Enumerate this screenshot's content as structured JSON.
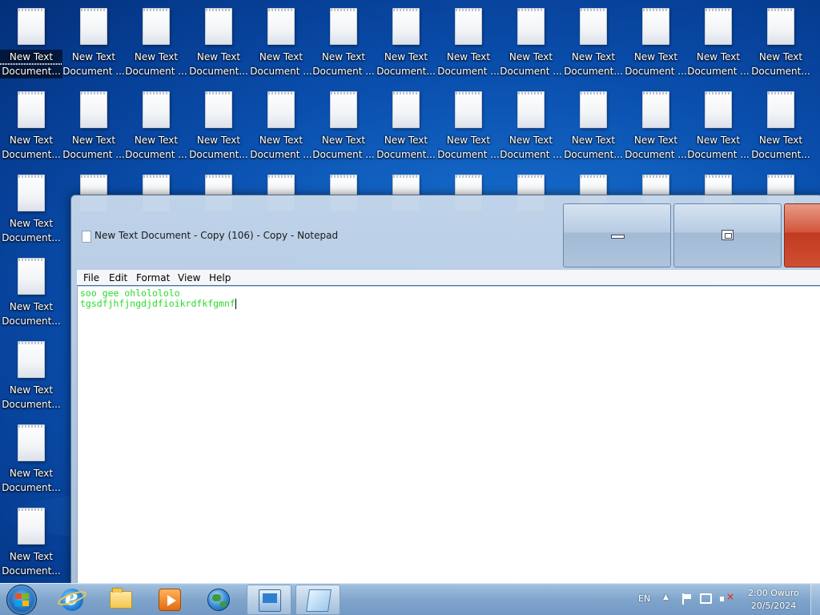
{
  "desktop": {
    "icon_label_line1": "New Text",
    "icon_label_line2_variants": [
      "Document ...",
      "Document..."
    ],
    "selected_index": 0
  },
  "notepad": {
    "title": "New Text Document - Copy (106) - Copy - Notepad",
    "menu": [
      "File",
      "Edit",
      "Format",
      "View",
      "Help"
    ],
    "content_line1": "soo gee ohlolololo",
    "content_line2": "tgsdfjhfjngdjdfioikrdfkfgmnf",
    "text_color": "#2adb2a"
  },
  "taskbar": {
    "start": "start-orb",
    "pinned": [
      {
        "name": "internet-explorer-icon"
      },
      {
        "name": "file-explorer-icon"
      },
      {
        "name": "media-player-icon"
      },
      {
        "name": "globe-network-icon"
      },
      {
        "name": "remote-desktop-icon"
      },
      {
        "name": "notepad-icon"
      }
    ],
    "language": "EN",
    "time": "2:00 Owuro",
    "date": "20/5/2024"
  },
  "colors": {
    "desktop_blue": "#0a4fae",
    "close_red": "#c13a1f",
    "window_chrome": "#b7cbe2"
  }
}
